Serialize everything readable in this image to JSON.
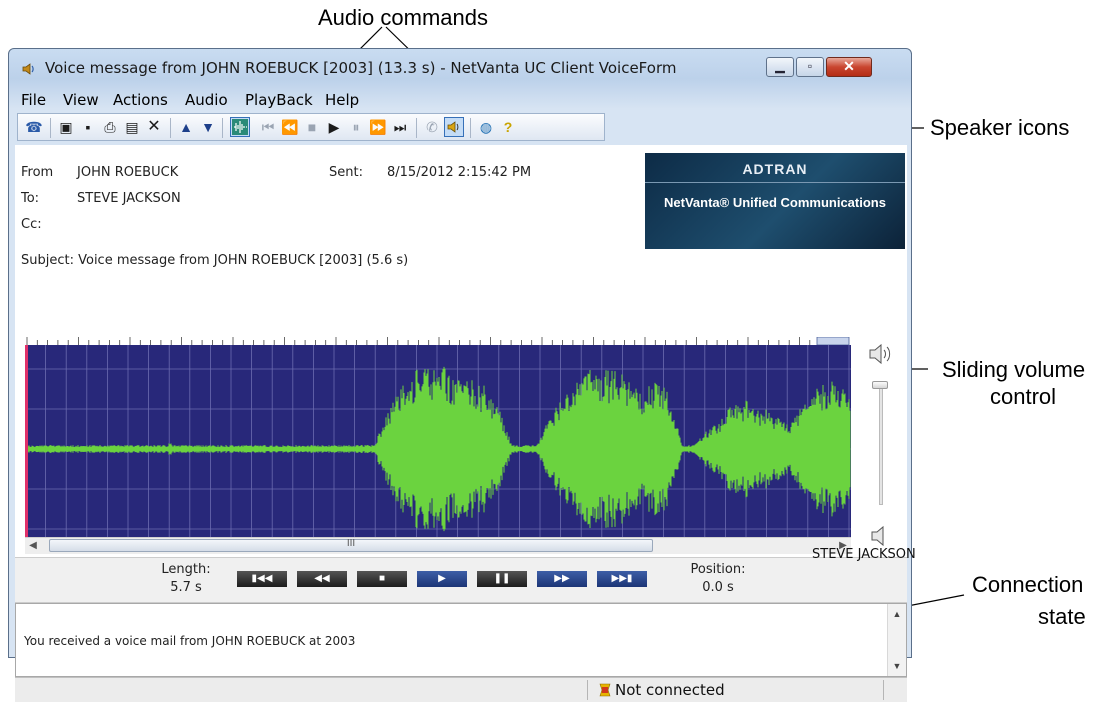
{
  "callouts": {
    "audio_commands": "Audio commands",
    "speaker_icons": "Speaker icons",
    "sliding_volume_line1": "Sliding volume",
    "sliding_volume_line2": "control",
    "connection_line1": "Connection",
    "connection_line2": "state"
  },
  "window": {
    "title": "Voice message from JOHN ROEBUCK [2003] (13.3 s) - NetVanta UC Client VoiceForm",
    "minimize_icon": "minimize-icon",
    "maximize_icon": "maximize-icon",
    "close_icon": "close-icon"
  },
  "menu": [
    "File",
    "View",
    "Actions",
    "Audio",
    "PlayBack",
    "Help"
  ],
  "toolbar_icons": {
    "reply": "reply-phone-icon",
    "save": "save-icon",
    "save_as": "save-as-icon",
    "print": "print-icon",
    "export": "export-icon",
    "delete": "delete-icon",
    "prev_message": "up-arrow-icon",
    "next_message": "down-arrow-icon",
    "waveform_view": "waveform-view-icon",
    "first": "skip-to-start-icon",
    "rewind": "rewind-icon",
    "stop": "stop-icon",
    "play": "play-icon",
    "pause": "pause-icon",
    "fast_forward": "fast-forward-icon",
    "last": "skip-to-end-icon",
    "handset": "handset-icon",
    "speaker": "speaker-icon",
    "web": "web-icon",
    "help": "help-icon"
  },
  "header": {
    "from_label": "From",
    "from_value": "JOHN ROEBUCK",
    "to_label": "To:",
    "to_value": "STEVE JACKSON",
    "cc_label": "Cc:",
    "sent_label": "Sent:",
    "sent_value": "8/15/2012 2:15:42 PM",
    "subject": "Subject: Voice message from JOHN ROEBUCK [2003] (5.6 s)"
  },
  "banner": {
    "logo": "ADTRAN",
    "text": "NetVanta® Unified Communications"
  },
  "waveform": {
    "bg_color": "#28287a",
    "wave_color": "#6bd33f",
    "cursor_color": "#e0306a"
  },
  "scrollbar": {
    "grip": "III"
  },
  "transport": {
    "length_label": "Length:",
    "length_value": "5.7 s",
    "position_label": "Position:",
    "position_value": "0.0 s",
    "buttons": [
      "skip-to-start",
      "rewind",
      "stop",
      "play",
      "pause",
      "fast-forward",
      "skip-to-end"
    ]
  },
  "message": {
    "text": "You received a voice mail from JOHN ROEBUCK at 2003"
  },
  "status": {
    "connection": "Not connected",
    "user": "STEVE JACKSON"
  }
}
